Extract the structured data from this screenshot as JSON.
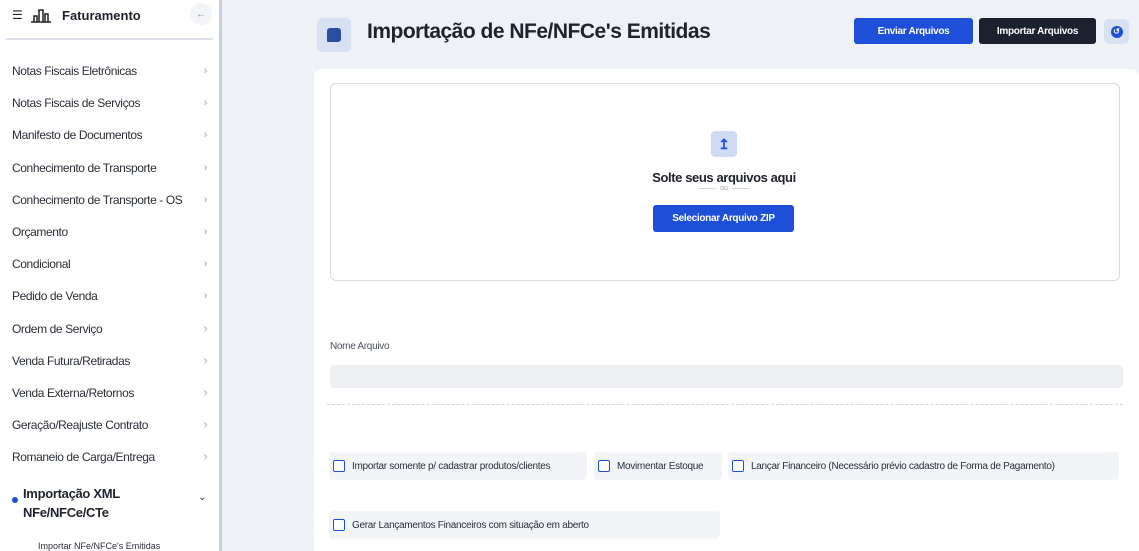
{
  "sidebar": {
    "title": "Faturamento",
    "menu_glyph": "☰",
    "collapse_glyph": "←",
    "items": [
      {
        "label": "Notas Fiscais Eletrônicas"
      },
      {
        "label": "Notas Fiscais de Serviços"
      },
      {
        "label": "Manifesto de Documentos"
      },
      {
        "label": "Conhecimento de Transporte"
      },
      {
        "label": "Conhecimento de Transporte - OS"
      },
      {
        "label": "Orçamento"
      },
      {
        "label": "Condicional"
      },
      {
        "label": "Pedido de Venda"
      },
      {
        "label": "Ordem de Serviço"
      },
      {
        "label": "Venda Futura/Retiradas"
      },
      {
        "label": "Venda Externa/Retornos"
      },
      {
        "label": "Geração/Reajuste Contrato"
      },
      {
        "label": "Romaneio de Carga/Entrega"
      }
    ],
    "chevron": "›",
    "active_group": {
      "label": "Importação XML NFe/NFCe/CTe",
      "chevron": "⌄"
    },
    "active_sub": "Importar NFe/NFCe's Emitidas"
  },
  "header": {
    "title": "Importação de NFe/NFCe's Emitidas",
    "send_label": "Enviar Arquivos",
    "import_label": "Importar Arquivos",
    "undo_glyph": "↺"
  },
  "dropzone": {
    "upload_glyph": "↥",
    "text": "Solte seus arquivos aqui",
    "or": "ou",
    "select_label": "Selecionar Arquivo ZIP"
  },
  "form": {
    "filename_label": "Nome Arquivo",
    "filename_value": ""
  },
  "options": [
    {
      "label": "Importar somente p/ cadastrar produtos/clientes",
      "checked": false
    },
    {
      "label": "Movimentar Estoque",
      "checked": false
    },
    {
      "label": "Lançar Financeiro (Necessário prévio cadastro de Forma de Pagamento)",
      "checked": false
    },
    {
      "label": "Gerar Lançamentos Financeiros com situação em aberto",
      "checked": false
    }
  ],
  "colors": {
    "accent": "#1d4fd8",
    "dark_button": "#1c2130",
    "background": "#eef1f6"
  }
}
